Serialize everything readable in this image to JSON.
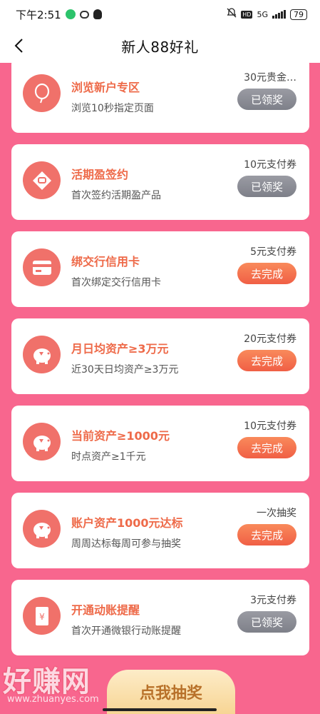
{
  "status_bar": {
    "time": "下午2:51",
    "network": "5G",
    "hd": "HD",
    "battery": "79"
  },
  "header": {
    "title": "新人88好礼"
  },
  "tasks": [
    {
      "title": "浏览新户专区",
      "desc": "浏览10秒指定页面",
      "reward": "30元贵金…",
      "button": "已领奖",
      "state": "claimed",
      "icon": "balloon-icon"
    },
    {
      "title": "活期盈签约",
      "desc": "首次签约活期盈产品",
      "reward": "10元支付券",
      "button": "已领奖",
      "state": "claimed",
      "icon": "diamond-tag-icon"
    },
    {
      "title": "绑交行信用卡",
      "desc": "首次绑定交行信用卡",
      "reward": "5元支付券",
      "button": "去完成",
      "state": "todo",
      "icon": "credit-card-icon"
    },
    {
      "title": "月日均资产≥3万元",
      "desc": "近30天日均资产≥3万元",
      "reward": "20元支付券",
      "button": "去完成",
      "state": "todo",
      "icon": "piggy-bank-icon"
    },
    {
      "title": "当前资产≥1000元",
      "desc": "时点资产≥1千元",
      "reward": "10元支付券",
      "button": "去完成",
      "state": "todo",
      "icon": "piggy-bank-icon"
    },
    {
      "title": "账户资产1000元达标",
      "desc": "周周达标每周可参与抽奖",
      "reward": "一次抽奖",
      "button": "去完成",
      "state": "todo",
      "icon": "piggy-bank-icon"
    },
    {
      "title": "开通动账提醒",
      "desc": "首次开通微银行动账提醒",
      "reward": "3元支付券",
      "button": "已领奖",
      "state": "claimed",
      "icon": "yen-note-icon"
    }
  ],
  "lottery": {
    "label": "点我抽奖"
  },
  "watermark": {
    "text": "好赚网",
    "url": "www.zhuanyes.com"
  },
  "colors": {
    "background": "#f8668e",
    "accent": "#ee6a49",
    "button_go": "#f26448",
    "button_claimed": "#888a93"
  }
}
